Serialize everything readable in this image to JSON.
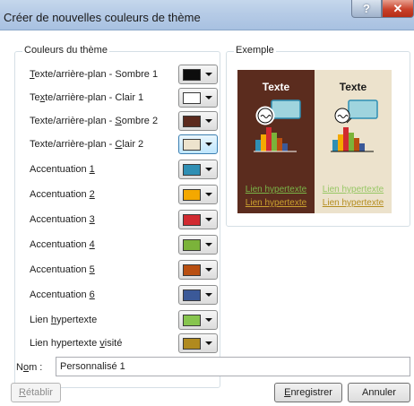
{
  "window": {
    "title": "Créer de nouvelles couleurs de thème",
    "help_glyph": "?",
    "close_glyph": "✕"
  },
  "colors_group": {
    "legend": "Couleurs du thème",
    "rows": [
      {
        "pre": "",
        "acc": "T",
        "post": "exte/arrière-plan - Sombre 1",
        "color": "#0d0d0d",
        "icon": "color-dropdown"
      },
      {
        "pre": "Te",
        "acc": "x",
        "post": "te/arrière-plan - Clair 1",
        "color": "#ffffff",
        "icon": "color-dropdown"
      },
      {
        "pre": "Texte/arrière-plan - ",
        "acc": "S",
        "post": "ombre 2",
        "color": "#5c2a1e",
        "icon": "color-dropdown"
      },
      {
        "pre": "Texte/arrière-plan - ",
        "acc": "C",
        "post": "lair 2",
        "color": "#ede3cd",
        "icon": "color-dropdown"
      },
      {
        "pre": "Accentuation ",
        "acc": "1",
        "post": "",
        "color": "#2f8fb4",
        "icon": "color-dropdown"
      },
      {
        "pre": "Accentuation ",
        "acc": "2",
        "post": "",
        "color": "#f4a800",
        "icon": "color-dropdown"
      },
      {
        "pre": "Accentuation ",
        "acc": "3",
        "post": "",
        "color": "#d12a30",
        "icon": "color-dropdown"
      },
      {
        "pre": "Accentuation ",
        "acc": "4",
        "post": "",
        "color": "#7bb33a",
        "icon": "color-dropdown"
      },
      {
        "pre": "Accentuation ",
        "acc": "5",
        "post": "",
        "color": "#b94f11",
        "icon": "color-dropdown"
      },
      {
        "pre": "Accentuation ",
        "acc": "6",
        "post": "",
        "color": "#3b5998",
        "icon": "color-dropdown"
      },
      {
        "pre": "Lien ",
        "acc": "h",
        "post": "ypertexte",
        "color": "#87c54e",
        "icon": "color-dropdown"
      },
      {
        "pre": "Lien hypertexte ",
        "acc": "v",
        "post": "isité",
        "color": "#b08a1f",
        "icon": "color-dropdown"
      }
    ]
  },
  "example_group": {
    "legend": "Exemple",
    "dark_panel": {
      "title": "Texte",
      "link": "Lien hypertexte",
      "visited_link": "Lien hypertexte"
    },
    "light_panel": {
      "title": "Texte",
      "link": "Lien hypertexte",
      "visited_link": "Lien hypertexte"
    }
  },
  "name_field": {
    "label_pre": "N",
    "label_acc": "o",
    "label_post": "m :",
    "value": "Personnalisé 1"
  },
  "buttons": {
    "reset_pre": "",
    "reset_acc": "R",
    "reset_post": "établir",
    "save_pre": "",
    "save_acc": "E",
    "save_post": "nregistrer",
    "cancel": "Annuler"
  },
  "accent": {
    "titlebar": "#b6cbe6",
    "close": "#c9412a"
  }
}
